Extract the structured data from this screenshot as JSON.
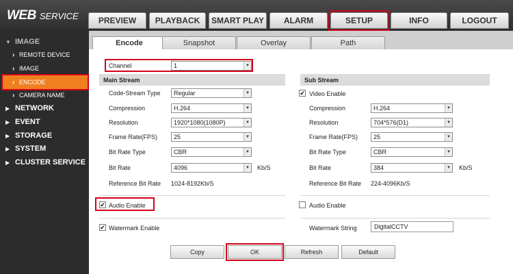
{
  "logo": {
    "word": "WEB",
    "rest": "SERVICE"
  },
  "nav": [
    "PREVIEW",
    "PLAYBACK",
    "SMART PLAY",
    "ALARM",
    "SETUP",
    "INFO",
    "LOGOUT"
  ],
  "sidebar": {
    "image": "IMAGE",
    "remote_device": "REMOTE DEVICE",
    "image_sub": "IMAGE",
    "encode": "ENCODE",
    "camera_name": "CAMERA NAME",
    "network": "NETWORK",
    "event": "EVENT",
    "storage": "STORAGE",
    "system": "SYSTEM",
    "cluster": "CLUSTER SERVICE"
  },
  "tabs": [
    "Encode",
    "Snapshot",
    "Overlay",
    "Path"
  ],
  "channel": {
    "label": "Channel",
    "value": "1"
  },
  "main_stream": {
    "title": "Main Stream",
    "code_stream_type": {
      "label": "Code-Stream Type",
      "value": "Regular"
    },
    "compression": {
      "label": "Compression",
      "value": "H.264"
    },
    "resolution": {
      "label": "Resolution",
      "value": "1920*1080(1080P)"
    },
    "frame_rate": {
      "label": "Frame Rate(FPS)",
      "value": "25"
    },
    "bit_rate_type": {
      "label": "Bit Rate Type",
      "value": "CBR"
    },
    "bit_rate": {
      "label": "Bit Rate",
      "value": "4096",
      "unit": "Kb/S"
    },
    "ref_bit_rate": {
      "label": "Reference Bit Rate",
      "value": "1024-8192Kb/S"
    },
    "audio_enable": {
      "label": "Audio Enable",
      "checked": true
    }
  },
  "sub_stream": {
    "title": "Sub Stream",
    "video_enable": {
      "label": "Video Enable",
      "checked": true
    },
    "compression": {
      "label": "Compression",
      "value": "H.264"
    },
    "resolution": {
      "label": "Resolution",
      "value": "704*576(D1)"
    },
    "frame_rate": {
      "label": "Frame Rate(FPS)",
      "value": "25"
    },
    "bit_rate_type": {
      "label": "Bit Rate Type",
      "value": "CBR"
    },
    "bit_rate": {
      "label": "Bit Rate",
      "value": "384",
      "unit": "Kb/S"
    },
    "ref_bit_rate": {
      "label": "Reference Bit Rate",
      "value": "224-4096Kb/S"
    },
    "audio_enable": {
      "label": "Audio Enable",
      "checked": false
    }
  },
  "watermark": {
    "enable_label": "Watermark Enable",
    "checked": true,
    "string_label": "Watermark String",
    "string_value": "DigitalCCTV"
  },
  "buttons": {
    "copy": "Copy",
    "ok": "OK",
    "refresh": "Refresh",
    "default": "Default"
  },
  "glyphs": {
    "check": "✔",
    "arrow": "▼",
    "tri_down": "▼",
    "tri_right": "▶",
    "chev": "›"
  },
  "colors": {
    "accent": "#f07f1f",
    "highlight": "#d0021b",
    "sidebar_bg": "#2c2c2c"
  }
}
